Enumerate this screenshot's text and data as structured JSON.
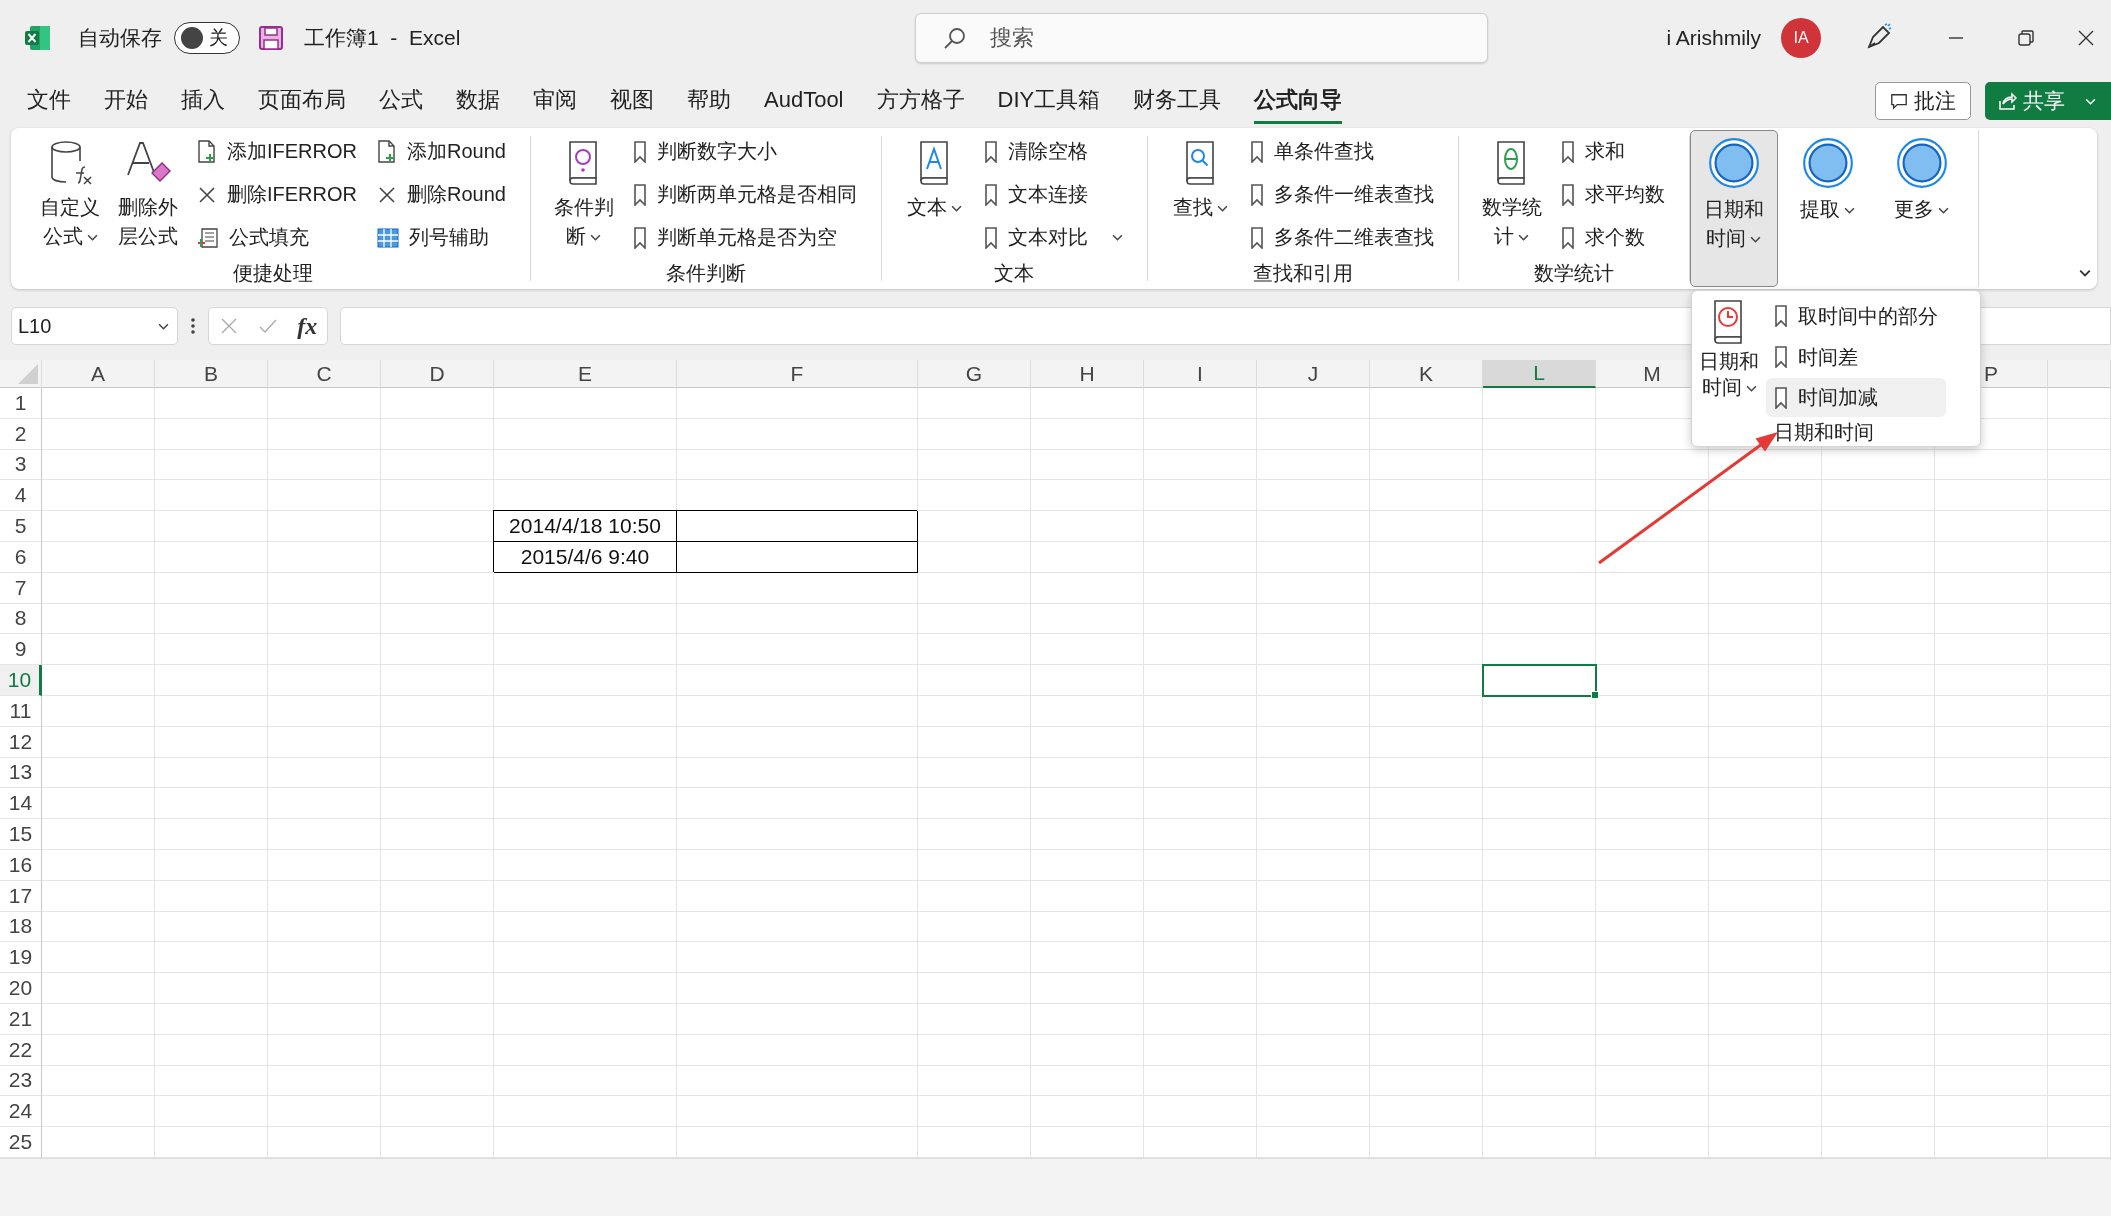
{
  "title_bar": {
    "autosave_label": "自动保存",
    "autosave_toggle": {
      "on": false,
      "label": "关"
    },
    "document_title": "工作簿1  -  Excel",
    "search": {
      "placeholder": "搜索"
    },
    "user_name": "i Arishmily",
    "avatar_initials": "IA"
  },
  "menu_tabs": [
    {
      "label": "文件",
      "selected": false
    },
    {
      "label": "开始",
      "selected": false
    },
    {
      "label": "插入",
      "selected": false
    },
    {
      "label": "页面布局",
      "selected": false
    },
    {
      "label": "公式",
      "selected": false
    },
    {
      "label": "数据",
      "selected": false
    },
    {
      "label": "审阅",
      "selected": false
    },
    {
      "label": "视图",
      "selected": false
    },
    {
      "label": "帮助",
      "selected": false
    },
    {
      "label": "AudTool",
      "selected": false
    },
    {
      "label": "方方格子",
      "selected": false
    },
    {
      "label": "DIY工具箱",
      "selected": false
    },
    {
      "label": "财务工具",
      "selected": false
    },
    {
      "label": "公式向导",
      "selected": true
    }
  ],
  "comments_button": "批注",
  "share_button": "共享",
  "ribbon": {
    "groups": [
      {
        "label": "便捷处理",
        "large_buttons": [
          {
            "label": "自定义公式",
            "kind": "cylinder",
            "has_menu": true,
            "pressed": false
          },
          {
            "label": "删除外层公式",
            "kind": "eraser",
            "has_menu": false,
            "pressed": false
          }
        ],
        "small_columns": [
          [
            {
              "label": "添加IFERROR",
              "kind": "add-file",
              "has_menu": false
            },
            {
              "label": "删除IFERROR",
              "kind": "cross",
              "has_menu": false
            },
            {
              "label": "公式填充",
              "kind": "fill",
              "has_menu": false
            }
          ],
          [
            {
              "label": "添加Round",
              "kind": "add-file",
              "has_menu": false
            },
            {
              "label": "删除Round",
              "kind": "cross",
              "has_menu": false
            },
            {
              "label": "列号辅助",
              "kind": "grid",
              "has_menu": false
            }
          ]
        ]
      },
      {
        "label": "条件判断",
        "large_buttons": [
          {
            "label": "条件判断",
            "kind": "book-purple",
            "has_menu": true,
            "pressed": false
          }
        ],
        "small_columns": [
          [
            {
              "label": "判断数字大小",
              "kind": "bookmark",
              "has_menu": false
            },
            {
              "label": "判断两单元格是否相同",
              "kind": "bookmark",
              "has_menu": false
            },
            {
              "label": "判断单元格是否为空",
              "kind": "bookmark",
              "has_menu": false
            }
          ]
        ]
      },
      {
        "label": "文本",
        "large_buttons": [
          {
            "label": "文本",
            "kind": "book-blue",
            "has_menu": true,
            "pressed": false
          }
        ],
        "small_columns": [
          [
            {
              "label": "清除空格",
              "kind": "bookmark",
              "has_menu": false
            },
            {
              "label": "文本连接",
              "kind": "bookmark",
              "has_menu": false
            },
            {
              "label": "文本对比",
              "kind": "bookmark",
              "has_menu": true
            }
          ]
        ]
      },
      {
        "label": "查找和引用",
        "large_buttons": [
          {
            "label": "查找",
            "kind": "book-search",
            "has_menu": true,
            "pressed": false
          }
        ],
        "small_columns": [
          [
            {
              "label": "单条件查找",
              "kind": "bookmark",
              "has_menu": false
            },
            {
              "label": "多条件一维表查找",
              "kind": "bookmark",
              "has_menu": false
            },
            {
              "label": "多条件二维表查找",
              "kind": "bookmark",
              "has_menu": false
            }
          ]
        ]
      },
      {
        "label": "数学统计",
        "large_buttons": [
          {
            "label": "数学统计",
            "kind": "book-green",
            "has_menu": true,
            "pressed": false
          }
        ],
        "small_columns": [
          [
            {
              "label": "求和",
              "kind": "bookmark",
              "has_menu": false
            },
            {
              "label": "求平均数",
              "kind": "bookmark",
              "has_menu": false
            },
            {
              "label": "求个数",
              "kind": "bookmark",
              "has_menu": false
            }
          ]
        ]
      },
      {
        "large_buttons": [
          {
            "label": "日期和时间",
            "kind": "circle",
            "has_menu": true,
            "pressed": true
          },
          {
            "label": "提取",
            "kind": "circle",
            "has_menu": true,
            "pressed": false
          },
          {
            "label": "更多",
            "kind": "circle",
            "has_menu": true,
            "pressed": false
          }
        ]
      }
    ]
  },
  "dropdown": {
    "large_button": {
      "label": "日期和时间",
      "kind": "book-clock",
      "has_menu": true
    },
    "items": [
      {
        "label": "取时间中的部分",
        "highlighted": false
      },
      {
        "label": "时间差",
        "highlighted": false
      },
      {
        "label": "时间加减",
        "highlighted": true
      }
    ],
    "group_label": "日期和时间"
  },
  "formula_bar": {
    "name_box": "L10",
    "function_button": "fx"
  },
  "sheet": {
    "columns": [
      {
        "label": "A",
        "selected": false
      },
      {
        "label": "B",
        "selected": false
      },
      {
        "label": "C",
        "selected": false
      },
      {
        "label": "D",
        "selected": false
      },
      {
        "label": "E",
        "selected": false
      },
      {
        "label": "F",
        "selected": false
      },
      {
        "label": "G",
        "selected": false
      },
      {
        "label": "H",
        "selected": false
      },
      {
        "label": "I",
        "selected": false
      },
      {
        "label": "J",
        "selected": false
      },
      {
        "label": "K",
        "selected": false
      },
      {
        "label": "L",
        "selected": true
      },
      {
        "label": "M",
        "selected": false
      },
      {},
      {},
      {
        "label": "P",
        "selected": false
      },
      {
        "selected": false
      }
    ],
    "rows": [
      {
        "label": "1",
        "selected": false
      },
      {
        "label": "2",
        "selected": false
      },
      {
        "label": "3",
        "selected": false
      },
      {
        "label": "4",
        "selected": false
      },
      {
        "label": "5",
        "selected": false,
        "cells": [
          {
            "border": false,
            "selected": false
          },
          {
            "border": false,
            "selected": false
          },
          {
            "border": false,
            "selected": false
          },
          {
            "border": false,
            "selected": false
          },
          {
            "value": "2014/4/18 10:50",
            "border": true,
            "selected": false
          },
          {
            "border": true,
            "selected": false
          }
        ]
      },
      {
        "label": "6",
        "selected": false,
        "cells": [
          {
            "border": false,
            "selected": false
          },
          {
            "border": false,
            "selected": false
          },
          {
            "border": false,
            "selected": false
          },
          {
            "border": false,
            "selected": false
          },
          {
            "value": "2015/4/6 9:40",
            "border": true,
            "selected": false
          },
          {
            "border": true,
            "selected": false
          }
        ]
      },
      {
        "label": "7",
        "selected": false
      },
      {
        "label": "8",
        "selected": false
      },
      {
        "label": "9",
        "selected": false
      },
      {
        "label": "10",
        "selected": true,
        "cells": [
          {
            "border": false,
            "selected": false
          },
          {
            "border": false,
            "selected": false
          },
          {
            "border": false,
            "selected": false
          },
          {
            "border": false,
            "selected": false
          },
          {
            "border": false,
            "selected": false
          },
          {
            "border": false,
            "selected": false
          },
          {
            "border": false,
            "selected": false
          },
          {
            "border": false,
            "selected": false
          },
          {
            "border": false,
            "selected": false
          },
          {
            "border": false,
            "selected": false
          },
          {
            "border": false,
            "selected": false
          },
          {
            "border": false,
            "selected": true
          }
        ]
      },
      {
        "label": "11",
        "selected": false
      },
      {
        "label": "12",
        "selected": false
      },
      {
        "label": "13",
        "selected": false
      },
      {
        "label": "14",
        "selected": false
      },
      {
        "label": "15",
        "selected": false
      },
      {
        "label": "16",
        "selected": false
      },
      {
        "label": "17",
        "selected": false
      },
      {
        "label": "18",
        "selected": false
      },
      {
        "label": "19",
        "selected": false
      },
      {
        "label": "20",
        "selected": false
      },
      {
        "label": "21",
        "selected": false
      },
      {
        "label": "22",
        "selected": false
      },
      {
        "label": "23",
        "selected": false
      },
      {
        "label": "24",
        "selected": false
      },
      {
        "label": "25",
        "selected": false
      }
    ]
  }
}
